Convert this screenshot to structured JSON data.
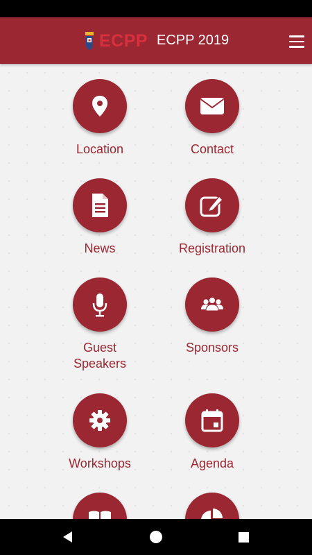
{
  "app_bar": {
    "logo_text": "ECPP",
    "title": "ECPP 2019",
    "menu_icon": "hamburger-menu-icon"
  },
  "colors": {
    "primary": "#9a2731",
    "logo_red": "#d9303d",
    "background": "#f2f2f2"
  },
  "tiles": [
    {
      "label": "Location",
      "icon": "map-pin-icon"
    },
    {
      "label": "Contact",
      "icon": "envelope-icon"
    },
    {
      "label": "News",
      "icon": "document-icon"
    },
    {
      "label": "Registration",
      "icon": "edit-icon"
    },
    {
      "label": "Guest\nSpeakers",
      "icon": "microphone-icon"
    },
    {
      "label": "Sponsors",
      "icon": "users-icon"
    },
    {
      "label": "Workshops",
      "icon": "gear-icon"
    },
    {
      "label": "Agenda",
      "icon": "calendar-icon"
    },
    {
      "label": "",
      "icon": "book-icon"
    },
    {
      "label": "",
      "icon": "pie-chart-icon"
    }
  ],
  "nav_bar": {
    "back_icon": "back-triangle-icon",
    "home_icon": "home-circle-icon",
    "recents_icon": "recents-square-icon"
  }
}
